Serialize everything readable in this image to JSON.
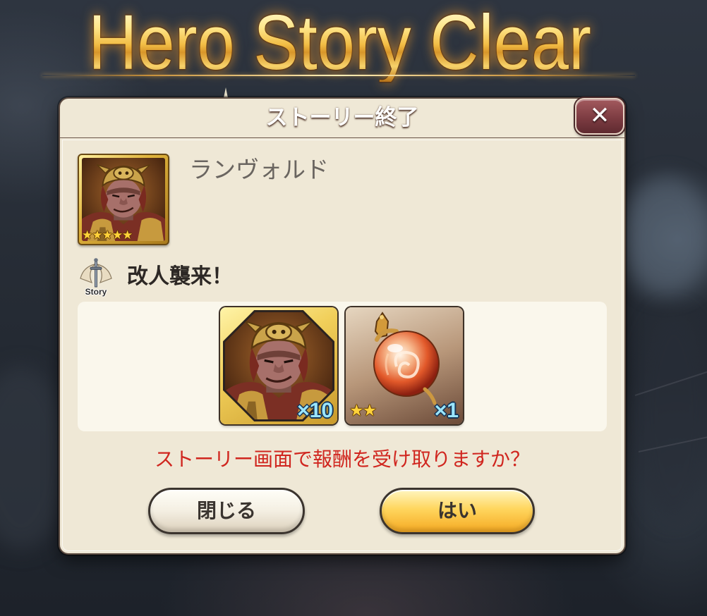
{
  "screen": {
    "banner_title": "Hero Story Clear"
  },
  "dialog": {
    "title": "ストーリー終了",
    "close_icon": "close-icon",
    "close_glyph": "✕",
    "hero": {
      "name": "ランヴォルド",
      "rarity_stars": "★★★★★",
      "portrait_icon": "hero-portrait-icon"
    },
    "story": {
      "icon": "story-sword-icon",
      "icon_label": "Story",
      "title": "改人襲来！"
    },
    "rewards": [
      {
        "icon": "hero-portrait-icon",
        "quantity": "×10"
      },
      {
        "icon": "orb-icon",
        "rarity_stars": "★★",
        "quantity": "×1"
      }
    ],
    "prompt": "ストーリー画面で報酬を受け取りますか？",
    "buttons": {
      "close": "閉じる",
      "confirm": "はい"
    }
  },
  "colors": {
    "title_gold": "#f2bd45",
    "prompt_red": "#d0261f",
    "quantity_cyan": "#9ae6ff",
    "confirm_orange": "#f5a922",
    "panel_cream": "#efe8d6"
  }
}
